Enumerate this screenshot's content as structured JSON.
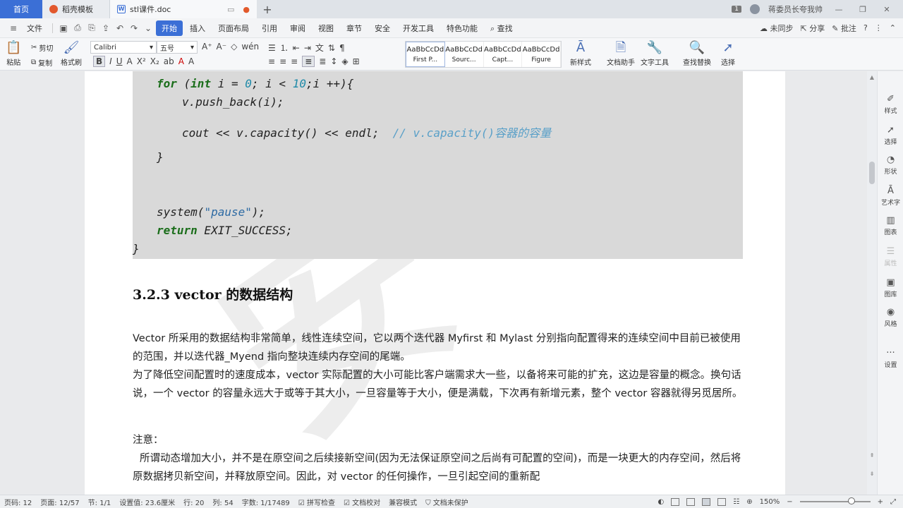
{
  "titlebar": {
    "tabs": [
      {
        "label": "首页"
      },
      {
        "label": "稻壳模板"
      },
      {
        "label": "stl课件.doc"
      }
    ],
    "page_count_badge": "1",
    "user_name": "蒋委员长夸我帅"
  },
  "menubar": {
    "file": "文件",
    "items": [
      "开始",
      "插入",
      "页面布局",
      "引用",
      "审阅",
      "视图",
      "章节",
      "安全",
      "开发工具",
      "特色功能"
    ],
    "search": "查找",
    "right": {
      "sync": "未同步",
      "share": "分享",
      "comment": "批注"
    }
  },
  "ribbon": {
    "paste": "粘贴",
    "cut": "剪切",
    "copy": "复制",
    "format_painter": "格式刷",
    "font_name": "Calibri",
    "font_size": "五号",
    "styles": [
      {
        "sample": "AaBbCcDd",
        "name": "First P..."
      },
      {
        "sample": "AaBbCcDd",
        "name": "Sourc..."
      },
      {
        "sample": "AaBbCcDd",
        "name": "Capt..."
      },
      {
        "sample": "AaBbCcDd",
        "name": "Figure"
      }
    ],
    "new_style": "新样式",
    "doc_assistant": "文档助手",
    "text_tools": "文字工具",
    "find_replace": "查找替换",
    "select": "选择"
  },
  "document": {
    "code": {
      "for_kw": "for",
      "for_open": " (",
      "int_kw": "int",
      "for_mid1": " i = ",
      "zero": "0",
      "for_mid2": "; i < ",
      "ten": "10",
      "for_end": ";i ++){",
      "push": "v.push_back(i);",
      "cout": "cout << v.capacity() << endl;",
      "comment": "// v.capacity()容器的容量",
      "close_inner": "}",
      "system_pre": "system(",
      "system_str": "\"pause\"",
      "system_post": ");",
      "return_kw": "return",
      "return_rest": " EXIT_SUCCESS;",
      "close_outer": "}"
    },
    "heading": "3.2.3 vector 的数据结构",
    "paragraphs": [
      "Vector 所采用的数据结构非常简单，线性连续空间，它以两个迭代器 Myfirst 和 Mylast 分别指向配置得来的连续空间中目前已被使用的范围，并以迭代器_Myend 指向整块连续内存空间的尾端。",
      "为了降低空间配置时的速度成本，vector 实际配置的大小可能比客户端需求大一些，以备将来可能的扩充，这边是容量的概念。换句话说，一个 vector 的容量永远大于或等于其大小，一旦容量等于大小，便是满载，下次再有新增元素，整个 vector 容器就得另觅居所。",
      "注意：",
      "所谓动态增加大小，并不是在原空间之后续接新空间(因为无法保证原空间之后尚有可配置的空间)，而是一块更大的内存空间，然后将原数据拷贝新空间，并释放原空间。因此，对 vector 的任何操作，一旦引起空间的重新配"
    ],
    "watermark": "安"
  },
  "sidebar": {
    "items": [
      {
        "label": "样式",
        "icon": "brush-icon"
      },
      {
        "label": "选择",
        "icon": "cursor-icon"
      },
      {
        "label": "形状",
        "icon": "shapes-icon"
      },
      {
        "label": "艺术字",
        "icon": "art-text-icon"
      },
      {
        "label": "图表",
        "icon": "chart-icon"
      },
      {
        "label": "属性",
        "icon": "properties-icon"
      },
      {
        "label": "图库",
        "icon": "gallery-icon"
      },
      {
        "label": "风格",
        "icon": "style-icon"
      },
      {
        "label": "设置",
        "icon": "settings-icon"
      }
    ]
  },
  "statusbar": {
    "page_code": "页码: 12",
    "page": "页面: 12/57",
    "section": "节: 1/1",
    "setting": "设置值: 23.6厘米",
    "row": "行: 20",
    "col": "列: 54",
    "words": "字数: 1/17489",
    "spell": "拼写检查",
    "proof": "文档校对",
    "compat": "兼容模式",
    "protect": "文档未保护",
    "zoom": "150%"
  }
}
